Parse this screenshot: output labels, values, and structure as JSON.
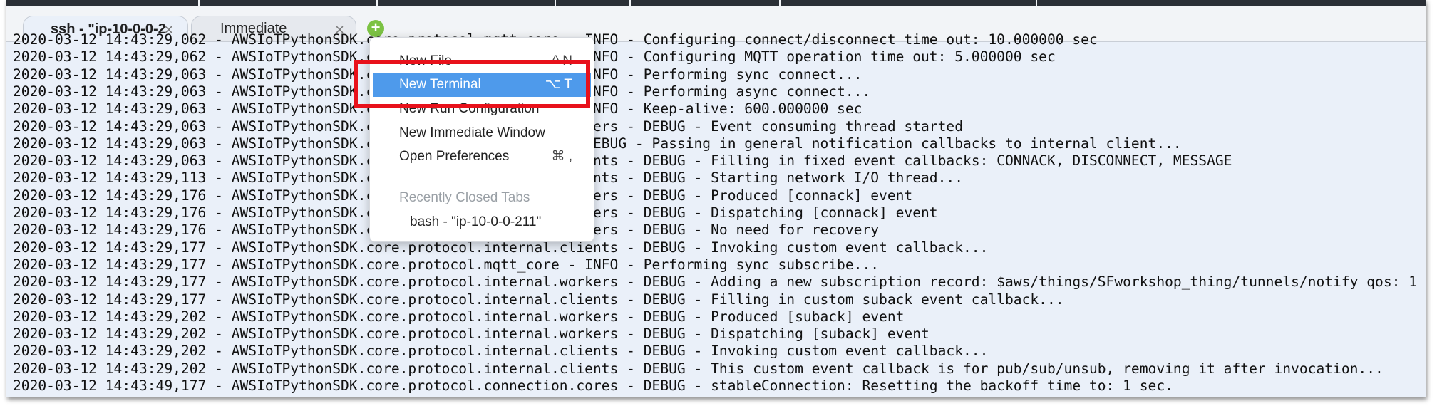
{
  "tabs": [
    {
      "label": "ssh - \"ip-10-0-0-2",
      "active": true,
      "close_icon": "close-icon"
    },
    {
      "label": "Immediate",
      "active": false,
      "close_icon": "close-icon"
    }
  ],
  "add_tab": {
    "icon": "plus-icon",
    "symbol": "+",
    "color": "#7cc243"
  },
  "menu": {
    "items": [
      {
        "label": "New File",
        "shortcut": "^ N"
      },
      {
        "label": "New Terminal",
        "shortcut": "⌥ T",
        "highlighted": true
      },
      {
        "label": "New Run Configuration",
        "shortcut": ""
      },
      {
        "label": "New Immediate Window",
        "shortcut": ""
      },
      {
        "label": "Open Preferences",
        "shortcut": "⌘ ,"
      }
    ],
    "recently_closed_header": "Recently Closed Tabs",
    "recently_closed": [
      "bash - \"ip-10-0-0-211\""
    ]
  },
  "colors": {
    "highlight": "#4e9aeb",
    "annotation_box": "#e8111b",
    "terminal_bg": "#eaf0f9"
  },
  "terminal": {
    "lines": [
      "2020-03-12 14:43:29,062 - AWSIoTPythonSDK.core.protocol.mqtt_core - INFO - Configuring connect/disconnect time out: 10.000000 sec",
      "2020-03-12 14:43:29,062 - AWSIoTPythonSDK.core.protocol.mqtt_core - INFO - Configuring MQTT operation time out: 5.000000 sec",
      "2020-03-12 14:43:29,063 - AWSIoTPythonSDK.core.protocol.mqtt_core - INFO - Performing sync connect...",
      "2020-03-12 14:43:29,063 - AWSIoTPythonSDK.core.protocol.mqtt_core - INFO - Performing async connect...",
      "2020-03-12 14:43:29,063 - AWSIoTPythonSDK.core.protocol.mqtt_core - INFO - Keep-alive: 600.000000 sec",
      "2020-03-12 14:43:29,063 - AWSIoTPythonSDK.core.protocol.internal.workers - DEBUG - Event consuming thread started",
      "2020-03-12 14:43:29,063 - AWSIoTPythonSDK.core.protocol.mqtt_core - DEBUG - Passing in general notification callbacks to internal client...",
      "2020-03-12 14:43:29,063 - AWSIoTPythonSDK.core.protocol.internal.clients - DEBUG - Filling in fixed event callbacks: CONNACK, DISCONNECT, MESSAGE",
      "2020-03-12 14:43:29,113 - AWSIoTPythonSDK.core.protocol.internal.clients - DEBUG - Starting network I/O thread...",
      "2020-03-12 14:43:29,176 - AWSIoTPythonSDK.core.protocol.internal.workers - DEBUG - Produced [connack] event",
      "2020-03-12 14:43:29,176 - AWSIoTPythonSDK.core.protocol.internal.workers - DEBUG - Dispatching [connack] event",
      "2020-03-12 14:43:29,176 - AWSIoTPythonSDK.core.protocol.internal.workers - DEBUG - No need for recovery",
      "2020-03-12 14:43:29,177 - AWSIoTPythonSDK.core.protocol.internal.clients - DEBUG - Invoking custom event callback...",
      "2020-03-12 14:43:29,177 - AWSIoTPythonSDK.core.protocol.mqtt_core - INFO - Performing sync subscribe...",
      "2020-03-12 14:43:29,177 - AWSIoTPythonSDK.core.protocol.internal.workers - DEBUG - Adding a new subscription record: $aws/things/SFworkshop_thing/tunnels/notify qos: 1",
      "2020-03-12 14:43:29,177 - AWSIoTPythonSDK.core.protocol.internal.clients - DEBUG - Filling in custom suback event callback...",
      "2020-03-12 14:43:29,202 - AWSIoTPythonSDK.core.protocol.internal.workers - DEBUG - Produced [suback] event",
      "2020-03-12 14:43:29,202 - AWSIoTPythonSDK.core.protocol.internal.workers - DEBUG - Dispatching [suback] event",
      "2020-03-12 14:43:29,202 - AWSIoTPythonSDK.core.protocol.internal.clients - DEBUG - Invoking custom event callback...",
      "2020-03-12 14:43:29,202 - AWSIoTPythonSDK.core.protocol.internal.clients - DEBUG - This custom event callback is for pub/sub/unsub, removing it after invocation...",
      "2020-03-12 14:43:49,177 - AWSIoTPythonSDK.core.protocol.connection.cores - DEBUG - stableConnection: Resetting the backoff time to: 1 sec."
    ]
  }
}
